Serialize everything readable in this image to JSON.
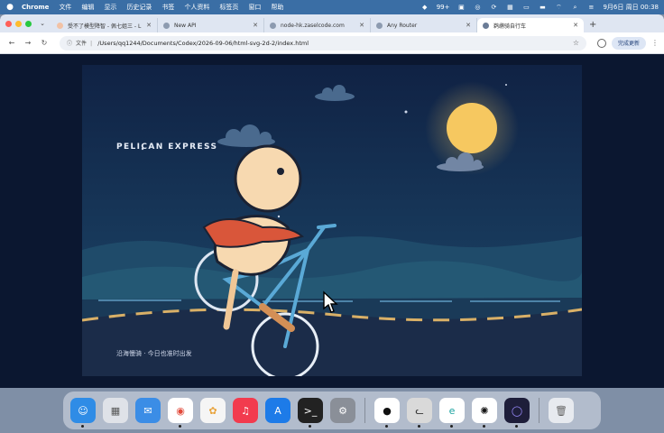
{
  "menubar": {
    "items": [
      "Chrome",
      "文件",
      "编辑",
      "显示",
      "历史记录",
      "书签",
      "个人资料",
      "标签页",
      "窗口",
      "帮助"
    ],
    "battery": "99+",
    "datetime": "9月6日 周日  00:38"
  },
  "tabs": [
    {
      "title": "受不了模型降智 - 佩七姐三 - L",
      "active": false
    },
    {
      "title": "New API",
      "active": false
    },
    {
      "title": "node-hk.zaselcode.com",
      "active": false
    },
    {
      "title": "Any Router",
      "active": false
    },
    {
      "title": "鹈鹕骑自行车",
      "active": true
    }
  ],
  "toolbar": {
    "info_label": "文件",
    "url": "/Users/qq1244/Documents/Codex/2026-09-06/html-svg-2d-2/index.html",
    "update_button": "完成更新"
  },
  "scene": {
    "brand": "PELICAN EXPRESS",
    "caption": "沿海慢骑 · 今日也准时出发"
  },
  "colors": {
    "sky_top": "#102244",
    "sky_bottom": "#1d4a6c",
    "moon": "#f6c860",
    "road": "#1b2c49",
    "dash": "#d9b067",
    "bike": "#5aa9d6"
  },
  "dock": [
    "finder-icon",
    "launchpad-icon",
    "mail-icon",
    "chrome-icon",
    "photos-icon",
    "music-icon",
    "app-store-icon",
    "terminal-icon",
    "system-settings-icon",
    "qq-icon",
    "cat-app-icon",
    "edge-icon",
    "chatgpt-icon",
    "orbit-app-icon",
    "trash-icon"
  ]
}
